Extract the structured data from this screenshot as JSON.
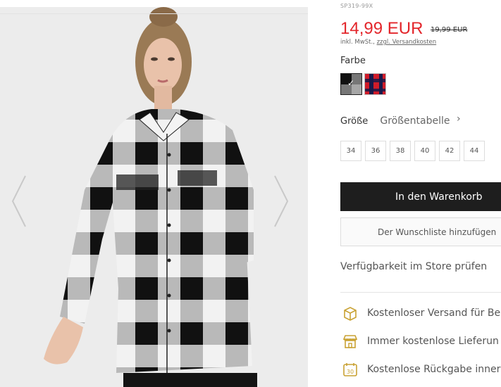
{
  "product": {
    "sku": "SP319-99X",
    "price": "14,99 EUR",
    "old_price": "19,99 EUR",
    "tax_text": "inkl. MwSt., ",
    "shipping_link": "zzgl. Versandkosten"
  },
  "colors": {
    "label": "Farbe",
    "options": [
      {
        "name": "black-white-check",
        "selected": true,
        "check_glyph": "✓"
      },
      {
        "name": "red-navy-check",
        "selected": false
      }
    ]
  },
  "sizes": {
    "label": "Größe",
    "guide": "Größentabelle",
    "chevron": "›",
    "options": [
      "34",
      "36",
      "38",
      "40",
      "42",
      "44"
    ]
  },
  "actions": {
    "add_to_cart": "In den Warenkorb",
    "wishlist": "Der Wunschliste hinzufügen",
    "store_availability": "Verfügbarkeit im Store prüfen"
  },
  "benefits": [
    {
      "icon": "box-icon",
      "text": "Kostenloser Versand für Be"
    },
    {
      "icon": "store-icon",
      "text": "Immer kostenlose Lieferun"
    },
    {
      "icon": "calendar-30-icon",
      "text": "Kostenlose Rückgabe inner"
    }
  ],
  "colors_hex": {
    "price_red": "#e3262b",
    "button_dark": "#1e1e1e",
    "icon_gold": "#c9a233"
  }
}
